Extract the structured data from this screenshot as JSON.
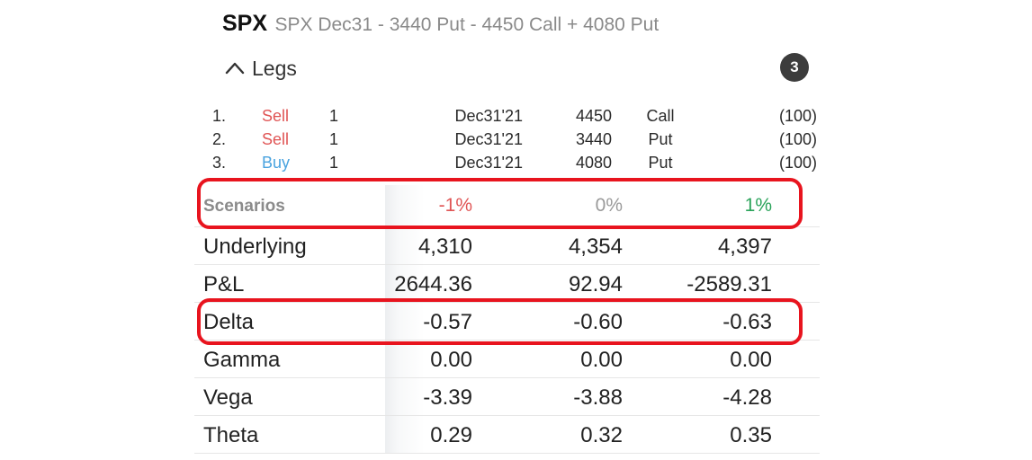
{
  "header": {
    "symbol": "SPX",
    "description": "SPX Dec31  - 3440 Put  - 4450 Call  + 4080 Put"
  },
  "legs_section": {
    "label": "Legs",
    "count": "3",
    "toggle_icon": "chevron-up-icon"
  },
  "legs": [
    {
      "num": "1.",
      "side": "Sell",
      "qty": "1",
      "expiry": "Dec31'21",
      "strike": "4450",
      "type": "Call",
      "multiplier": "(100)"
    },
    {
      "num": "2.",
      "side": "Sell",
      "qty": "1",
      "expiry": "Dec31'21",
      "strike": "3440",
      "type": "Put",
      "multiplier": "(100)"
    },
    {
      "num": "3.",
      "side": "Buy",
      "qty": "1",
      "expiry": "Dec31'21",
      "strike": "4080",
      "type": "Put",
      "multiplier": "(100)"
    }
  ],
  "scenarios": {
    "label": "Scenarios",
    "columns": [
      "-1%",
      "0%",
      "1%"
    ],
    "rows": [
      {
        "label": "Underlying",
        "values": [
          "4,310",
          "4,354",
          "4,397"
        ]
      },
      {
        "label": "P&L",
        "values": [
          "2644.36",
          "92.94",
          "-2589.31"
        ]
      },
      {
        "label": "Delta",
        "values": [
          "-0.57",
          "-0.60",
          "-0.63"
        ]
      },
      {
        "label": "Gamma",
        "values": [
          "0.00",
          "0.00",
          "0.00"
        ]
      },
      {
        "label": "Vega",
        "values": [
          "-3.39",
          "-3.88",
          "-4.28"
        ]
      },
      {
        "label": "Theta",
        "values": [
          "0.29",
          "0.32",
          "0.35"
        ]
      }
    ]
  },
  "colors": {
    "sell": "#e05555",
    "buy": "#4aa3df",
    "negative_scenario": "#e05555",
    "neutral_scenario": "#9a9a9a",
    "positive_scenario": "#2aa35a",
    "highlight": "#e8141e"
  }
}
